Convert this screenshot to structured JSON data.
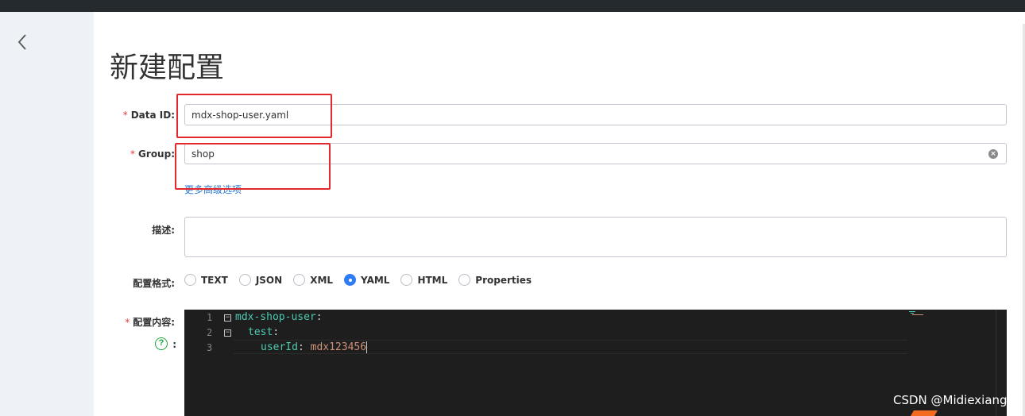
{
  "page": {
    "title": "新建配置"
  },
  "form": {
    "data_id": {
      "required_mark": "*",
      "label": "Data ID:",
      "value": "mdx-shop-user.yaml"
    },
    "group": {
      "required_mark": "*",
      "label": "Group:",
      "value": "shop"
    },
    "advanced_link": "更多高级选项",
    "description": {
      "label": "描述:",
      "value": ""
    },
    "format": {
      "label": "配置格式:",
      "options": [
        "TEXT",
        "JSON",
        "XML",
        "YAML",
        "HTML",
        "Properties"
      ],
      "selected": "YAML"
    },
    "content": {
      "required_mark": "*",
      "label": "配置内容:",
      "help_colon": ":",
      "help_icon": "?",
      "lines": [
        {
          "num": "1",
          "key": "mdx-shop-user",
          "sep": ":",
          "value": ""
        },
        {
          "num": "2",
          "key": "test",
          "sep": ":",
          "value": ""
        },
        {
          "num": "3",
          "key": "userId",
          "sep": ": ",
          "value": "mdx123456"
        }
      ]
    }
  },
  "watermark": "CSDN @Midiexiang_",
  "colors": {
    "accent": "#2f7cf6",
    "required": "#e4393c",
    "highlight_box": "#e2282a",
    "editor_bg": "#1e1e1e",
    "yaml_key": "#4ec9b0",
    "yaml_value": "#ce9178",
    "help_icon": "#1fa33b"
  },
  "icons": {
    "back": "chevron-left-icon",
    "clear": "clear-circle-icon",
    "help": "help-circle-icon"
  }
}
